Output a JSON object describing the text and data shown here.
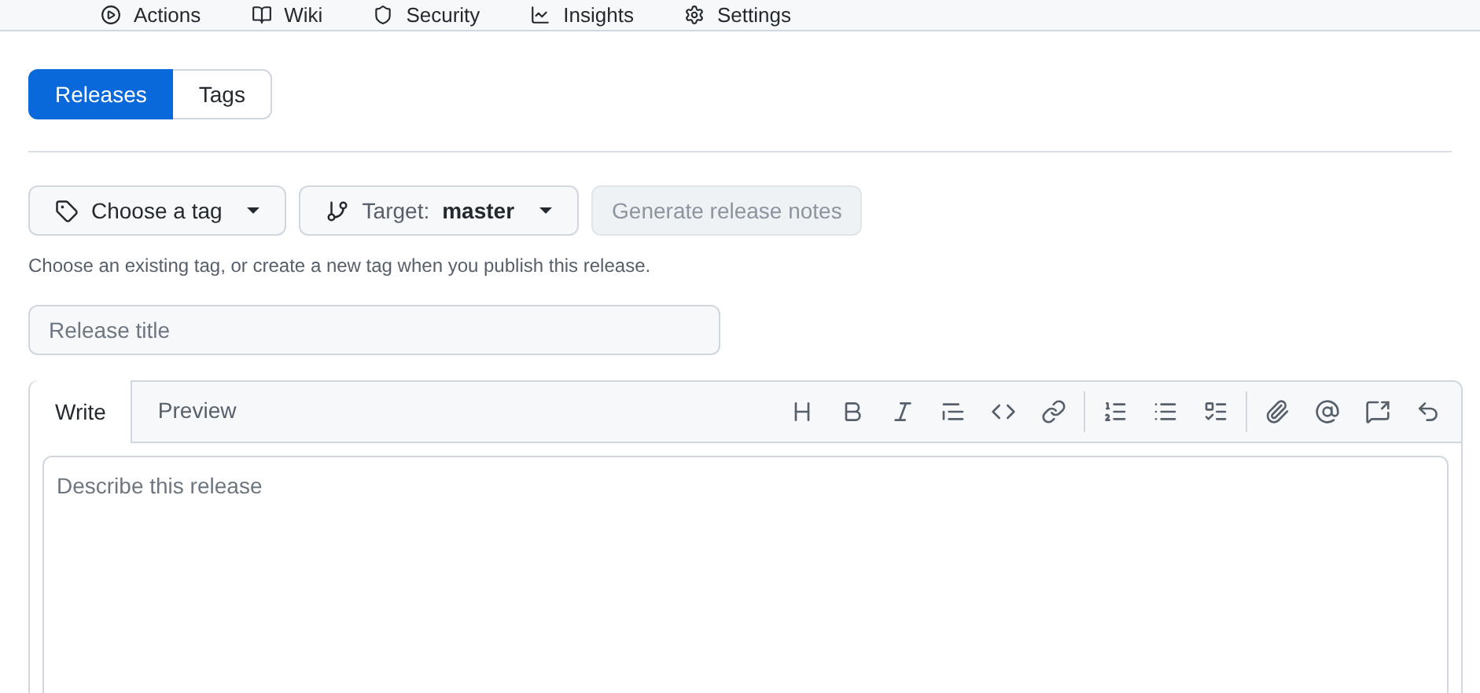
{
  "nav": [
    {
      "label": "Actions"
    },
    {
      "label": "Wiki"
    },
    {
      "label": "Security"
    },
    {
      "label": "Insights"
    },
    {
      "label": "Settings"
    }
  ],
  "release_tabs": [
    {
      "label": "Releases",
      "selected": true
    },
    {
      "label": "Tags",
      "selected": false
    }
  ],
  "tag_button": {
    "label": "Choose a tag"
  },
  "target_button": {
    "label": "Target:",
    "value": "master"
  },
  "generate_button": {
    "label": "Generate release notes",
    "disabled": true
  },
  "tag_hint": "Choose an existing tag, or create a new tag when you publish this release.",
  "title_field": {
    "placeholder": "Release title"
  },
  "editor": {
    "tabs": [
      {
        "label": "Write",
        "selected": true
      },
      {
        "label": "Preview",
        "selected": false
      }
    ],
    "placeholder": "Describe this release"
  }
}
